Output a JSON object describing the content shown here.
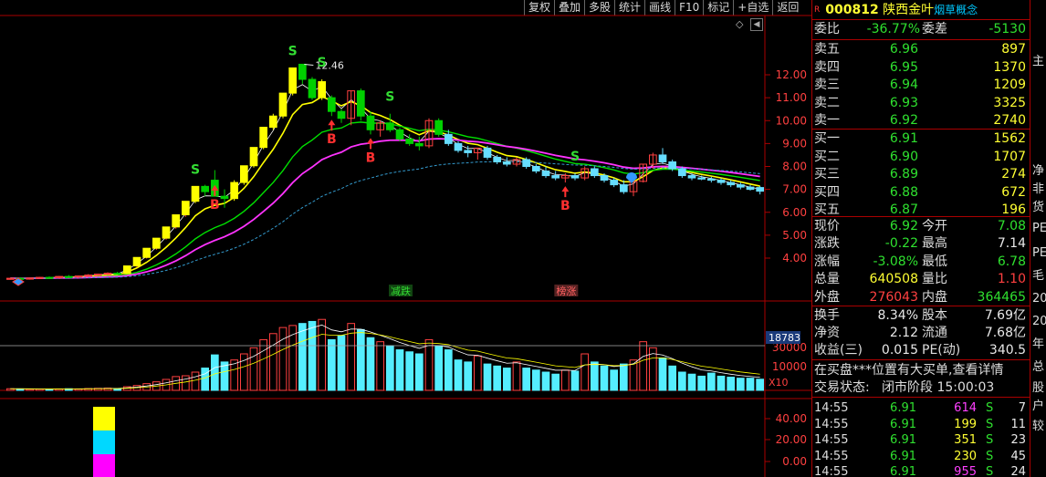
{
  "toolbar": [
    "复权",
    "叠加",
    "多股",
    "统计",
    "画线",
    "F10",
    "标记",
    "+自选",
    "返回"
  ],
  "stock": {
    "code": "000812",
    "name": "陕西金叶",
    "concept": "烟草概念",
    "r_badge": "R"
  },
  "weibi": {
    "label1": "委比",
    "value1": "-36.77%",
    "label2": "委差",
    "value2": "-5130"
  },
  "asks": [
    {
      "label": "卖五",
      "price": "6.96",
      "volume": "897"
    },
    {
      "label": "卖四",
      "price": "6.95",
      "volume": "1370"
    },
    {
      "label": "卖三",
      "price": "6.94",
      "volume": "1209"
    },
    {
      "label": "卖二",
      "price": "6.93",
      "volume": "3325"
    },
    {
      "label": "卖一",
      "price": "6.92",
      "volume": "2740"
    }
  ],
  "bids": [
    {
      "label": "买一",
      "price": "6.91",
      "volume": "1562"
    },
    {
      "label": "买二",
      "price": "6.90",
      "volume": "1707"
    },
    {
      "label": "买三",
      "price": "6.89",
      "volume": "274"
    },
    {
      "label": "买四",
      "price": "6.88",
      "volume": "672"
    },
    {
      "label": "买五",
      "price": "6.87",
      "volume": "196"
    }
  ],
  "quote": [
    {
      "l1": "现价",
      "v1": "6.92",
      "l2": "今开",
      "v2": "7.08"
    },
    {
      "l1": "涨跌",
      "v1": "-0.22",
      "l2": "最高",
      "v2": "7.14"
    },
    {
      "l1": "涨幅",
      "v1": "-3.08%",
      "l2": "最低",
      "v2": "6.78"
    },
    {
      "l1": "总量",
      "v1": "640508",
      "l2": "量比",
      "v2": "1.10"
    },
    {
      "l1": "外盘",
      "v1": "276043",
      "l2": "内盘",
      "v2": "364465"
    }
  ],
  "fund": [
    {
      "l1": "换手",
      "v1": "8.34%",
      "l2": "股本",
      "v2": "7.69亿"
    },
    {
      "l1": "净资",
      "v1": "2.12",
      "l2": "流通",
      "v2": "7.68亿"
    },
    {
      "l1": "收益(三)",
      "v1": "0.015",
      "l2": "PE(动)",
      "v2": "340.5"
    }
  ],
  "notice": "在买盘***位置有大买单,查看详情",
  "status": {
    "label": "交易状态:",
    "value": "闭市阶段 15:00:03"
  },
  "ticks": [
    {
      "time": "14:55",
      "price": "6.91",
      "volume": "614",
      "side": "S",
      "count": "7"
    },
    {
      "time": "14:55",
      "price": "6.91",
      "volume": "199",
      "side": "S",
      "count": "11"
    },
    {
      "time": "14:55",
      "price": "6.91",
      "volume": "351",
      "side": "S",
      "count": "23"
    },
    {
      "time": "14:55",
      "price": "6.91",
      "volume": "230",
      "side": "S",
      "count": "45"
    },
    {
      "time": "14:55",
      "price": "6.91",
      "volume": "955",
      "side": "S",
      "count": "24"
    }
  ],
  "strip_chars": [
    "主",
    "净",
    "非",
    "货",
    "PE",
    "PE",
    "毛",
    "20",
    "20",
    "年",
    "总",
    "股",
    "户",
    "较"
  ],
  "chart_data": {
    "type": "candlestick",
    "price_axis": {
      "ticks": [
        "12.00",
        "11.00",
        "10.00",
        "9.00",
        "8.00",
        "7.00",
        "6.00",
        "5.00",
        "4.00"
      ]
    },
    "high_label": "12.46",
    "candles": [
      [
        3.1,
        3.14,
        3.06,
        3.12
      ],
      [
        3.12,
        3.16,
        3.08,
        3.1
      ],
      [
        3.1,
        3.14,
        3.06,
        3.13
      ],
      [
        3.13,
        3.18,
        3.1,
        3.16
      ],
      [
        3.16,
        3.2,
        3.12,
        3.14
      ],
      [
        3.14,
        3.22,
        3.12,
        3.2
      ],
      [
        3.2,
        3.26,
        3.16,
        3.18
      ],
      [
        3.18,
        3.24,
        3.14,
        3.22
      ],
      [
        3.22,
        3.3,
        3.18,
        3.26
      ],
      [
        3.26,
        3.32,
        3.22,
        3.3
      ],
      [
        3.3,
        3.38,
        3.26,
        3.34
      ],
      [
        3.34,
        3.4,
        3.28,
        3.32
      ],
      [
        3.32,
        3.66,
        3.3,
        3.66
      ],
      [
        3.66,
        4.03,
        3.6,
        4.03
      ],
      [
        4.03,
        4.43,
        3.98,
        4.43
      ],
      [
        4.43,
        4.87,
        4.36,
        4.87
      ],
      [
        4.87,
        5.36,
        4.8,
        5.36
      ],
      [
        5.36,
        5.89,
        5.28,
        5.89
      ],
      [
        5.89,
        6.48,
        5.8,
        6.48
      ],
      [
        6.48,
        7.13,
        6.4,
        7.13
      ],
      [
        7.13,
        7.2,
        6.7,
        6.9
      ],
      [
        7.4,
        7.84,
        7.35,
        6.7
      ],
      [
        6.7,
        7.0,
        6.2,
        6.6
      ],
      [
        6.6,
        7.4,
        6.5,
        7.3
      ],
      [
        7.3,
        8.03,
        7.2,
        8.03
      ],
      [
        8.03,
        8.83,
        7.95,
        8.83
      ],
      [
        8.83,
        9.71,
        8.75,
        9.71
      ],
      [
        9.71,
        10.3,
        9.6,
        10.2
      ],
      [
        10.2,
        11.2,
        10.1,
        11.2
      ],
      [
        11.2,
        12.3,
        11.1,
        12.3
      ],
      [
        12.46,
        12.46,
        11.6,
        11.8
      ],
      [
        11.8,
        11.9,
        10.9,
        11.0
      ],
      [
        11.0,
        11.8,
        10.9,
        11.7
      ],
      [
        11.0,
        11.1,
        10.2,
        10.4
      ],
      [
        10.4,
        10.5,
        9.9,
        10.1
      ],
      [
        10.1,
        11.3,
        9.8,
        11.3
      ],
      [
        11.3,
        11.4,
        10.0,
        10.2
      ],
      [
        10.2,
        10.4,
        9.4,
        9.6
      ],
      [
        9.6,
        10.0,
        9.3,
        9.9
      ],
      [
        9.9,
        10.3,
        9.5,
        9.6
      ],
      [
        9.6,
        9.7,
        9.1,
        9.2
      ],
      [
        9.2,
        9.4,
        8.9,
        9.0
      ],
      [
        9.0,
        9.3,
        8.7,
        8.9
      ],
      [
        8.9,
        10.1,
        8.8,
        10.0
      ],
      [
        10.0,
        10.1,
        9.3,
        9.4
      ],
      [
        9.4,
        9.6,
        8.9,
        9.0
      ],
      [
        9.0,
        9.1,
        8.6,
        8.7
      ],
      [
        8.7,
        8.9,
        8.4,
        8.6
      ],
      [
        8.6,
        8.8,
        8.3,
        8.8
      ],
      [
        8.8,
        8.9,
        8.3,
        8.4
      ],
      [
        8.4,
        8.5,
        8.1,
        8.2
      ],
      [
        8.2,
        8.4,
        8.0,
        8.1
      ],
      [
        8.1,
        8.4,
        8.0,
        8.3
      ],
      [
        8.3,
        8.4,
        7.9,
        8.0
      ],
      [
        8.0,
        8.1,
        7.7,
        7.8
      ],
      [
        7.8,
        8.0,
        7.5,
        7.6
      ],
      [
        7.6,
        7.8,
        7.4,
        7.5
      ],
      [
        7.5,
        7.7,
        7.3,
        7.6
      ],
      [
        7.6,
        7.7,
        7.4,
        7.5
      ],
      [
        7.5,
        8.0,
        7.4,
        7.9
      ],
      [
        7.9,
        8.0,
        7.5,
        7.6
      ],
      [
        7.6,
        7.7,
        7.3,
        7.4
      ],
      [
        7.4,
        7.5,
        7.1,
        7.2
      ],
      [
        7.2,
        7.4,
        6.8,
        6.9
      ],
      [
        6.9,
        7.4,
        6.7,
        7.35
      ],
      [
        7.35,
        8.1,
        7.3,
        8.1
      ],
      [
        8.1,
        8.6,
        7.9,
        8.5
      ],
      [
        8.5,
        8.8,
        8.1,
        8.2
      ],
      [
        8.2,
        8.3,
        7.8,
        7.9
      ],
      [
        7.9,
        8.0,
        7.5,
        7.6
      ],
      [
        7.6,
        7.7,
        7.4,
        7.5
      ],
      [
        7.5,
        7.6,
        7.4,
        7.45
      ],
      [
        7.45,
        7.55,
        7.3,
        7.4
      ],
      [
        7.4,
        7.5,
        7.2,
        7.3
      ],
      [
        7.3,
        7.4,
        7.1,
        7.2
      ],
      [
        7.2,
        7.3,
        7.0,
        7.1
      ],
      [
        7.1,
        7.2,
        6.95,
        7.0
      ],
      [
        7.08,
        7.14,
        6.78,
        6.92
      ]
    ],
    "signals": [
      {
        "text": "S",
        "i": 29
      },
      {
        "text": "S",
        "i": 32
      },
      {
        "text": "S",
        "i": 39
      },
      {
        "text": "S",
        "i": 58
      },
      {
        "text": "S",
        "i": 19
      },
      {
        "text": "B",
        "i": 33
      },
      {
        "text": "B",
        "i": 37
      },
      {
        "text": "B",
        "i": 21
      },
      {
        "text": "B",
        "i": 57
      }
    ],
    "tags": [
      {
        "text": "减跌",
        "i": 40
      },
      {
        "text": "榜涨",
        "i": 57
      }
    ],
    "volume_axis": {
      "ticks": [
        "30000",
        "10000"
      ],
      "current": "18783",
      "multiplier": "X10"
    },
    "volumes": [
      800,
      700,
      600,
      650,
      600,
      700,
      800,
      700,
      900,
      1000,
      1100,
      900,
      1800,
      2400,
      3300,
      4200,
      5400,
      6800,
      7200,
      9000,
      11000,
      17500,
      14000,
      15000,
      18000,
      21000,
      25000,
      28000,
      31000,
      32000,
      33000,
      34000,
      35000,
      25000,
      27000,
      33000,
      30000,
      26000,
      24000,
      22000,
      20000,
      19000,
      18000,
      25000,
      22000,
      20000,
      15000,
      14000,
      17000,
      13000,
      12000,
      11000,
      14000,
      11000,
      10000,
      9000,
      8000,
      10000,
      9500,
      18000,
      14000,
      12000,
      10000,
      13000,
      15000,
      24000,
      21000,
      16000,
      12000,
      9000,
      8000,
      7000,
      8500,
      7000,
      6500,
      6000,
      6000,
      5500
    ],
    "indicator_axis": {
      "ticks": [
        "40.00",
        "20.00",
        "0.00"
      ]
    },
    "indicator_colors": [
      "#ffff00",
      "#00d8ff",
      "#ff00ff"
    ]
  }
}
